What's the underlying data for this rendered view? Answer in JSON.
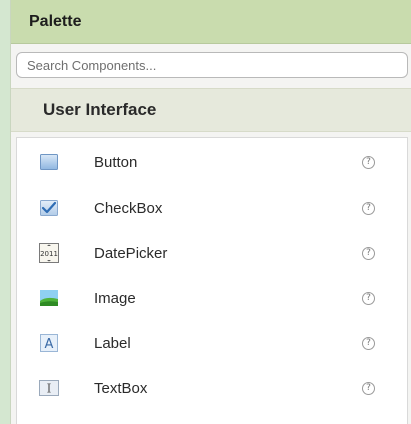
{
  "palette": {
    "title": "Palette",
    "search": {
      "placeholder": "Search Components...",
      "value": ""
    },
    "category": "User Interface",
    "components": [
      {
        "label": "Button",
        "icon": "button-icon"
      },
      {
        "label": "CheckBox",
        "icon": "checkbox-icon"
      },
      {
        "label": "DatePicker",
        "icon": "datepicker-icon",
        "icon_text": "2011"
      },
      {
        "label": "Image",
        "icon": "image-icon"
      },
      {
        "label": "Label",
        "icon": "label-icon",
        "icon_text": "A"
      },
      {
        "label": "TextBox",
        "icon": "textbox-icon",
        "icon_text": "I"
      }
    ],
    "help_glyph": "?"
  }
}
